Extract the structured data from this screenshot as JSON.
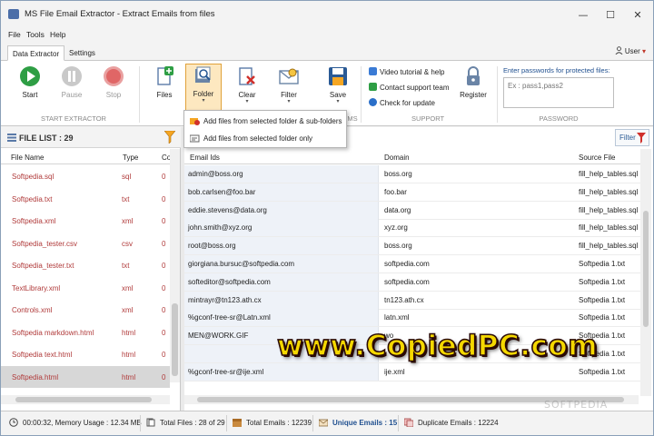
{
  "window": {
    "title": "MS File Email Extractor - Extract Emails from files",
    "controls": {
      "minimize": "—",
      "maximize": "☐",
      "close": "✕"
    }
  },
  "menubar": [
    "File",
    "Tools",
    "Help"
  ],
  "tabs": {
    "items": [
      "Data Extractor",
      "Settings"
    ],
    "active": 0,
    "user_label": "User",
    "user_caret": "▾"
  },
  "ribbon": {
    "start": {
      "label": "Start",
      "icon": "play-icon",
      "color": "#2e9e44"
    },
    "pause": {
      "label": "Pause",
      "icon": "pause-icon",
      "disabled": true
    },
    "stop": {
      "label": "Stop",
      "icon": "stop-icon",
      "disabled": true,
      "color": "#e06666"
    },
    "group_start_extractor": "START EXTRACTOR",
    "files": {
      "label": "Files",
      "icon": "add-file-icon"
    },
    "folder": {
      "label": "Folder",
      "icon": "folder-search-icon",
      "dropdown": "▾"
    },
    "clear": {
      "label": "Clear",
      "icon": "clear-icon",
      "dropdown": "▾"
    },
    "filter": {
      "label": "Filter",
      "icon": "filter-mail-icon",
      "dropdown": "▾"
    },
    "save": {
      "label": "Save",
      "icon": "save-icon",
      "dropdown": "▾"
    },
    "group_items_partial": "MS",
    "support_links": [
      {
        "label": "Video tutorial & help",
        "icon": "video-icon"
      },
      {
        "label": "Contact support team",
        "icon": "support-icon"
      },
      {
        "label": "Check for update",
        "icon": "update-icon"
      }
    ],
    "group_support": "SUPPORT",
    "register": {
      "label": "Register",
      "icon": "lock-icon"
    },
    "password": {
      "label": "Enter passwords for protected files:",
      "value": "Ex : pass1,pass2"
    },
    "group_password": "PASSWORD"
  },
  "folder_menu": [
    {
      "label": "Add files from selected folder & sub-folders",
      "icon": "folder-tree-icon"
    },
    {
      "label": "Add files from selected folder only",
      "icon": "folder-single-icon"
    }
  ],
  "file_list": {
    "title": "FILE LIST : 29",
    "columns": [
      "File Name",
      "Type",
      "Co"
    ],
    "rows": [
      {
        "name": "Softpedia.sql",
        "type": "sql",
        "count": "0"
      },
      {
        "name": "Softpedia.txt",
        "type": "txt",
        "count": "0"
      },
      {
        "name": "Softpedia.xml",
        "type": "xml",
        "count": "0"
      },
      {
        "name": "Softpedia_tester.csv",
        "type": "csv",
        "count": "0"
      },
      {
        "name": "Softpedia_tester.txt",
        "type": "txt",
        "count": "0"
      },
      {
        "name": "TextLibrary.xml",
        "type": "xml",
        "count": "0"
      },
      {
        "name": "Controls.xml",
        "type": "xml",
        "count": "0"
      },
      {
        "name": "Softpedia markdown.html",
        "type": "html",
        "count": "0"
      },
      {
        "name": "Softpedia text.html",
        "type": "html",
        "count": "0"
      },
      {
        "name": "Softpedia.html",
        "type": "html",
        "count": "0"
      }
    ],
    "selected_row": 9,
    "splitter_dots": "⋮"
  },
  "email_table": {
    "filter_label": "Filter",
    "columns": [
      "Email Ids",
      "Domain",
      "Source File"
    ],
    "rows": [
      {
        "email": "admin@boss.org",
        "domain": "boss.org",
        "source": "fill_help_tables.sql"
      },
      {
        "email": "bob.carlsen@foo.bar",
        "domain": "foo.bar",
        "source": "fill_help_tables.sql"
      },
      {
        "email": "eddie.stevens@data.org",
        "domain": "data.org",
        "source": "fill_help_tables.sql"
      },
      {
        "email": "john.smith@xyz.org",
        "domain": "xyz.org",
        "source": "fill_help_tables.sql"
      },
      {
        "email": "root@boss.org",
        "domain": "boss.org",
        "source": "fill_help_tables.sql"
      },
      {
        "email": "giorgiana.bursuc@softpedia.com",
        "domain": "softpedia.com",
        "source": "Softpedia 1.txt"
      },
      {
        "email": "softeditor@softpedia.com",
        "domain": "softpedia.com",
        "source": "Softpedia 1.txt"
      },
      {
        "email": "mintrayr@tn123.ath.cx",
        "domain": "tn123.ath.cx",
        "source": "Softpedia 1.txt"
      },
      {
        "email": "%gconf-tree-sr@Latn.xml",
        "domain": "latn.xml",
        "source": "Softpedia 1.txt"
      },
      {
        "email": "MEN@WORK.GIF",
        "domain": "wo",
        "source": "Softpedia 1.txt"
      },
      {
        "email": "",
        "domain": "",
        "source": "Softpedia 1.txt"
      },
      {
        "email": "%gconf-tree-sr@ije.xml",
        "domain": "ije.xml",
        "source": "Softpedia 1.txt"
      }
    ]
  },
  "watermark": "www.CopiedPC.com",
  "softpedia_mark": "SOFTPEDIA",
  "status": {
    "time": "00:00:32, Memory Usage : 12.34 MB",
    "total_files_label": "Total Files :",
    "total_files": "28 of 29",
    "total_emails_label": "Total Emails :",
    "total_emails": "12239",
    "unique_label": "Unique Emails :",
    "unique": "15",
    "duplicate_label": "Duplicate Emails :",
    "duplicate": "12224"
  }
}
